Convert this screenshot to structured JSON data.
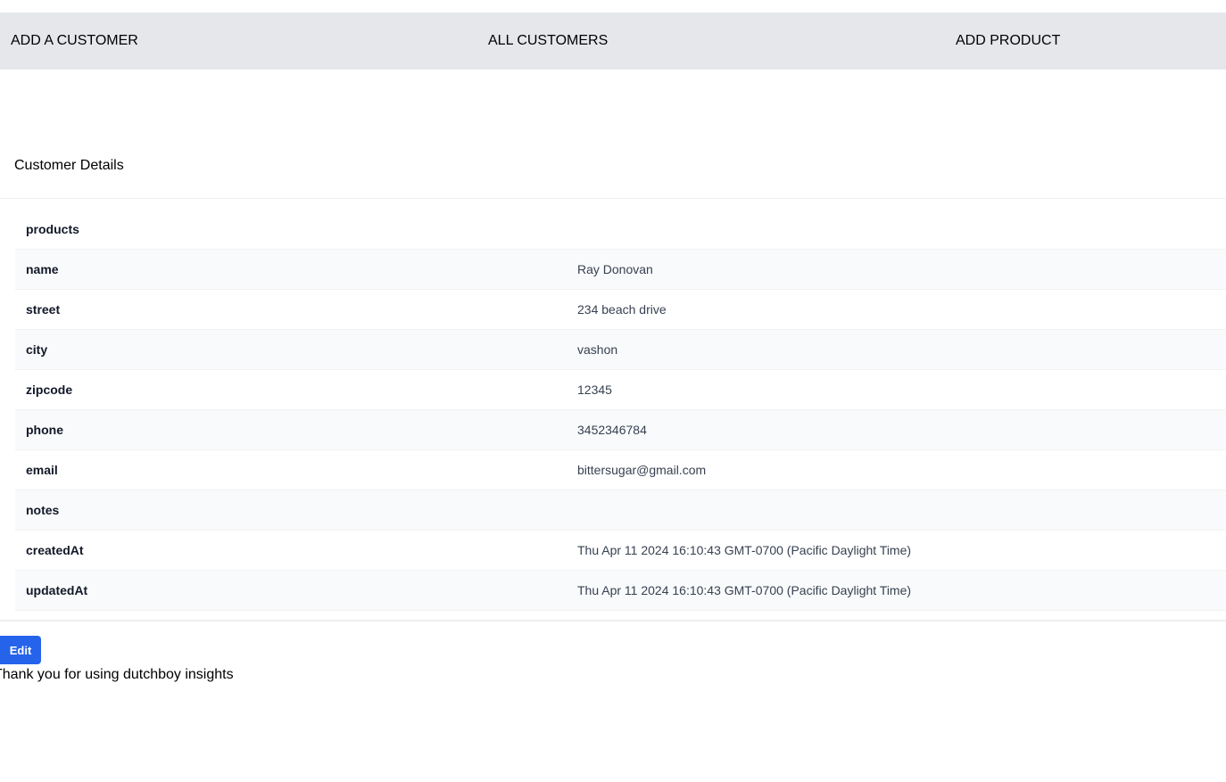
{
  "nav": {
    "links": [
      {
        "label": "ADD A CUSTOMER"
      },
      {
        "label": "ALL CUSTOMERS"
      },
      {
        "label": "ADD PRODUCT"
      }
    ]
  },
  "details": {
    "title": "Customer Details",
    "rows": [
      {
        "key": "products",
        "value": ""
      },
      {
        "key": "name",
        "value": "Ray Donovan"
      },
      {
        "key": "street",
        "value": "234 beach drive"
      },
      {
        "key": "city",
        "value": "vashon"
      },
      {
        "key": "zipcode",
        "value": "12345"
      },
      {
        "key": "phone",
        "value": "3452346784"
      },
      {
        "key": "email",
        "value": "bittersugar@gmail.com"
      },
      {
        "key": "notes",
        "value": ""
      },
      {
        "key": "createdAt",
        "value": "Thu Apr 11 2024 16:10:43 GMT-0700 (Pacific Daylight Time)"
      },
      {
        "key": "updatedAt",
        "value": "Thu Apr 11 2024 16:10:43 GMT-0700 (Pacific Daylight Time)"
      }
    ]
  },
  "actions": {
    "edit_label": "Edit"
  },
  "footer": {
    "text": "Thank you for using dutchboy insights"
  },
  "colors": {
    "nav_bg": "#e5e7eb",
    "button_bg": "#2563eb",
    "row_alt_bg": "#f9fafb"
  }
}
